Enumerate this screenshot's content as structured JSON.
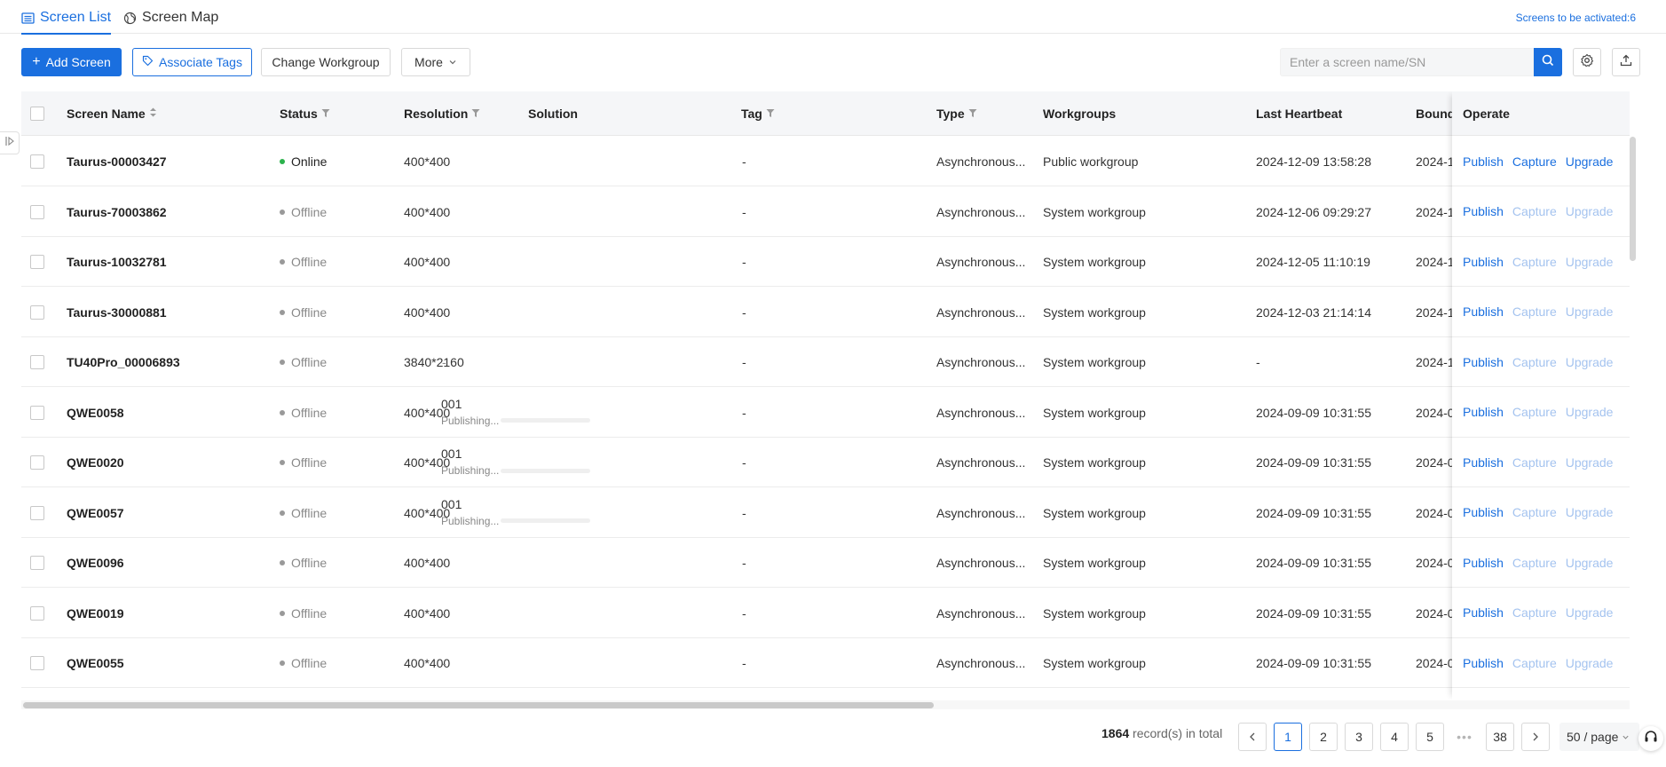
{
  "tabs": {
    "screen_list": "Screen List",
    "screen_map": "Screen Map"
  },
  "activate_link": "Screens to be activated:6",
  "toolbar": {
    "add_screen": "Add Screen",
    "associate_tags": "Associate Tags",
    "change_workgroup": "Change Workgroup",
    "more": "More"
  },
  "search": {
    "placeholder": "Enter a screen name/SN",
    "value": ""
  },
  "columns": {
    "screen_name": "Screen Name",
    "status": "Status",
    "resolution": "Resolution",
    "solution": "Solution",
    "tag": "Tag",
    "type": "Type",
    "workgroups": "Workgroups",
    "last_heartbeat": "Last Heartbeat",
    "bound": "Bound",
    "operate": "Operate"
  },
  "operate_actions": {
    "publish": "Publish",
    "capture": "Capture",
    "upgrade": "Upgrade"
  },
  "rows": [
    {
      "name": "Taurus-00003427",
      "status": "Online",
      "resolution": "400*400",
      "solution": "-",
      "solution_publishing": false,
      "tag": "-",
      "type": "Asynchronous...",
      "workgroup": "Public workgroup",
      "heartbeat": "2024-12-09 13:58:28",
      "bound": "2024-1"
    },
    {
      "name": "Taurus-70003862",
      "status": "Offline",
      "resolution": "400*400",
      "solution": "-",
      "solution_publishing": false,
      "tag": "-",
      "type": "Asynchronous...",
      "workgroup": "System workgroup",
      "heartbeat": "2024-12-06 09:29:27",
      "bound": "2024-1"
    },
    {
      "name": "Taurus-10032781",
      "status": "Offline",
      "resolution": "400*400",
      "solution": "-",
      "solution_publishing": false,
      "tag": "-",
      "type": "Asynchronous...",
      "workgroup": "System workgroup",
      "heartbeat": "2024-12-05 11:10:19",
      "bound": "2024-1"
    },
    {
      "name": "Taurus-30000881",
      "status": "Offline",
      "resolution": "400*400",
      "solution": "-",
      "solution_publishing": false,
      "tag": "-",
      "type": "Asynchronous...",
      "workgroup": "System workgroup",
      "heartbeat": "2024-12-03 21:14:14",
      "bound": "2024-1"
    },
    {
      "name": "TU40Pro_00006893",
      "status": "Offline",
      "resolution": "3840*2160",
      "solution": "-",
      "solution_publishing": false,
      "tag": "-",
      "type": "Asynchronous...",
      "workgroup": "System workgroup",
      "heartbeat": "-",
      "bound": "2024-1"
    },
    {
      "name": "QWE0058",
      "status": "Offline",
      "resolution": "400*400",
      "solution": "001",
      "solution_publishing": true,
      "publishing_label": "Publishing...",
      "publishing_progress": 0,
      "tag": "-",
      "type": "Asynchronous...",
      "workgroup": "System workgroup",
      "heartbeat": "2024-09-09 10:31:55",
      "bound": "2024-0"
    },
    {
      "name": "QWE0020",
      "status": "Offline",
      "resolution": "400*400",
      "solution": "001",
      "solution_publishing": true,
      "publishing_label": "Publishing...",
      "publishing_progress": 0,
      "tag": "-",
      "type": "Asynchronous...",
      "workgroup": "System workgroup",
      "heartbeat": "2024-09-09 10:31:55",
      "bound": "2024-0"
    },
    {
      "name": "QWE0057",
      "status": "Offline",
      "resolution": "400*400",
      "solution": "001",
      "solution_publishing": true,
      "publishing_label": "Publishing...",
      "publishing_progress": 0,
      "tag": "-",
      "type": "Asynchronous...",
      "workgroup": "System workgroup",
      "heartbeat": "2024-09-09 10:31:55",
      "bound": "2024-0"
    },
    {
      "name": "QWE0096",
      "status": "Offline",
      "resolution": "400*400",
      "solution": "-",
      "solution_publishing": false,
      "tag": "-",
      "type": "Asynchronous...",
      "workgroup": "System workgroup",
      "heartbeat": "2024-09-09 10:31:55",
      "bound": "2024-0"
    },
    {
      "name": "QWE0019",
      "status": "Offline",
      "resolution": "400*400",
      "solution": "-",
      "solution_publishing": false,
      "tag": "-",
      "type": "Asynchronous...",
      "workgroup": "System workgroup",
      "heartbeat": "2024-09-09 10:31:55",
      "bound": "2024-0"
    },
    {
      "name": "QWE0055",
      "status": "Offline",
      "resolution": "400*400",
      "solution": "-",
      "solution_publishing": false,
      "tag": "-",
      "type": "Asynchronous...",
      "workgroup": "System workgroup",
      "heartbeat": "2024-09-09 10:31:55",
      "bound": "2024-0"
    }
  ],
  "pagination": {
    "total_count": "1864",
    "total_suffix": "record(s) in total",
    "pages": [
      "1",
      "2",
      "3",
      "4",
      "5"
    ],
    "current": "1",
    "ellipsis": "•••",
    "last_page": "38",
    "page_size": "50 / page"
  },
  "colors": {
    "accent": "#1a6fdf",
    "online": "#2bb24c",
    "offline": "#999999"
  },
  "icons": {
    "screen_list_tab": "list-icon",
    "screen_map_tab": "globe-icon",
    "add": "plus-icon",
    "associate_tags": "tag-icon",
    "more": "chevron-down-icon",
    "search": "search-icon",
    "settings": "gear-icon",
    "export": "upload-icon",
    "sidebar": "expand-sidebar-icon",
    "help": "headset-icon"
  }
}
